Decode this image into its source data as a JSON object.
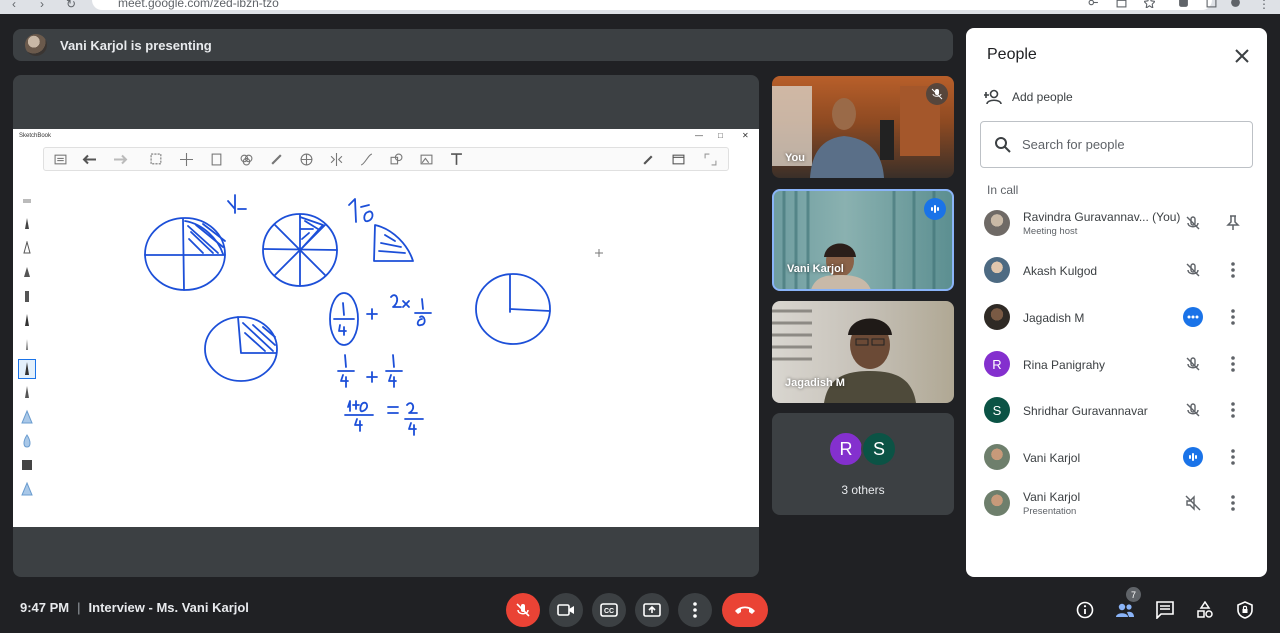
{
  "browser": {
    "url": "meet.google.com/zed-ibzn-tzo"
  },
  "banner": {
    "text": "Vani Karjol is presenting"
  },
  "sketchbook": {
    "title": "SketchBook"
  },
  "tiles": [
    {
      "name": "You",
      "muted": true
    },
    {
      "name": "Vani Karjol",
      "speaking": true
    },
    {
      "name": "Jagadish M"
    }
  ],
  "others": {
    "initials": [
      "R",
      "S"
    ],
    "label": "3 others"
  },
  "panel": {
    "title": "People",
    "add_people": "Add people",
    "search_placeholder": "Search for people",
    "section": "In call",
    "participants": [
      {
        "name": "Ravindra Guravannav... (You)",
        "sub": "Meeting host",
        "status": "muted",
        "action": "pin"
      },
      {
        "name": "Akash Kulgod",
        "sub": "",
        "status": "muted",
        "action": "more"
      },
      {
        "name": "Jagadish M",
        "sub": "",
        "status": "speaking-dots",
        "action": "more"
      },
      {
        "name": "Rina Panigrahy",
        "sub": "",
        "initial": "R",
        "color": "#8430ce",
        "status": "muted",
        "action": "more"
      },
      {
        "name": "Shridhar Guravannavar",
        "sub": "",
        "initial": "S",
        "color": "#0b5345",
        "status": "muted",
        "action": "more"
      },
      {
        "name": "Vani Karjol",
        "sub": "",
        "status": "speaking",
        "action": "more"
      },
      {
        "name": "Vani Karjol",
        "sub": "Presentation",
        "status": "volume-off",
        "action": "more"
      }
    ]
  },
  "bottom": {
    "time": "9:47 PM",
    "meeting_name": "Interview - Ms. Vani Karjol",
    "people_count": "7"
  },
  "colors": {
    "accent": "#1a73e8",
    "danger": "#ea4335",
    "surface": "#3c4043",
    "background": "#202124"
  }
}
